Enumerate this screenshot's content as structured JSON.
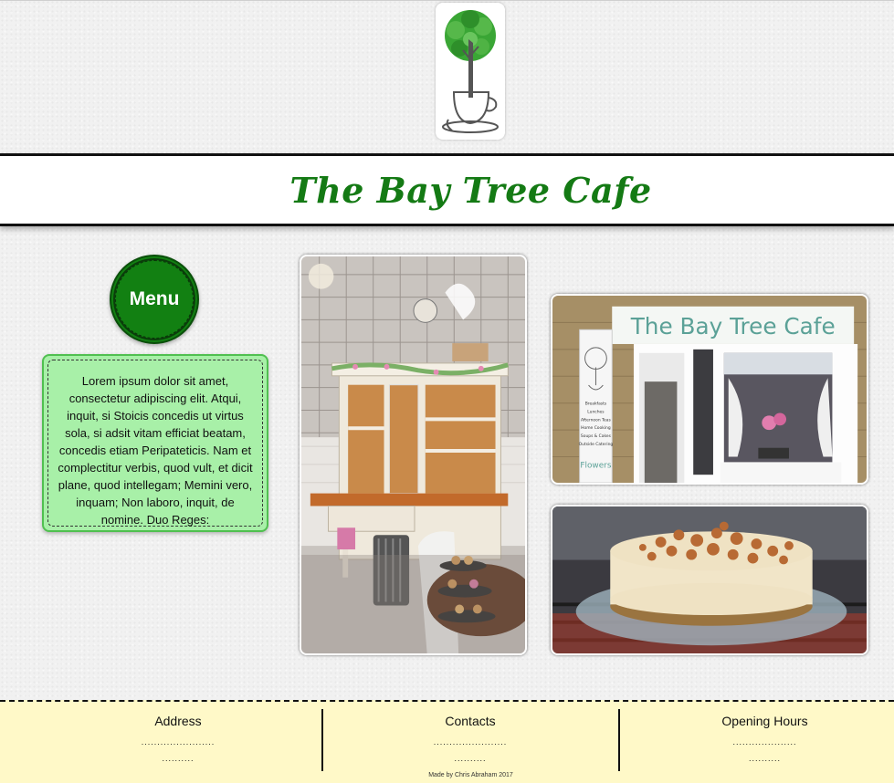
{
  "header": {
    "logo_icon": "bay-tree-coffee-cup-logo",
    "title": "The Bay Tree Cafe"
  },
  "sidebar": {
    "menu_label": "Menu",
    "intro_text": "Lorem ipsum dolor sit amet, consectetur adipiscing elit. Atqui, inquit, si Stoicis concedis ut virtus sola, si adsit vitam efficiat beatam, concedis etiam Peripateticis. Nam et complectitur verbis, quod vult, et dicit plane, quod intellegam; Memini vero, inquam; Non laboro, inquit, de nomine. Duo Reges:"
  },
  "gallery": {
    "interior_photo": "cafe-interior-dresser-photo",
    "storefront_photo": "cafe-storefront-photo",
    "storefront_sign": "The Bay Tree Cafe",
    "board_lines": [
      "Breakfasts",
      "Lunches",
      "Afternoon Teas",
      "Home Cooking",
      "Soups & Cakes",
      "Outside Catering"
    ],
    "board_footer": "Flowers",
    "cake_photo": "cheesecake-photo"
  },
  "footer": {
    "address": {
      "heading": "Address",
      "line1": ".......................",
      "line2": ".........."
    },
    "contacts": {
      "heading": "Contacts",
      "line1": ".......................",
      "line2": ".........."
    },
    "hours": {
      "heading": "Opening Hours",
      "line1": "....................",
      "line2": ".........."
    },
    "credit": "Made by Chris Abraham 2017"
  },
  "colors": {
    "brand_green": "#147a14",
    "menu_green": "#128012",
    "intro_bg": "#a8f0a8",
    "footer_bg": "#fff9c8"
  }
}
